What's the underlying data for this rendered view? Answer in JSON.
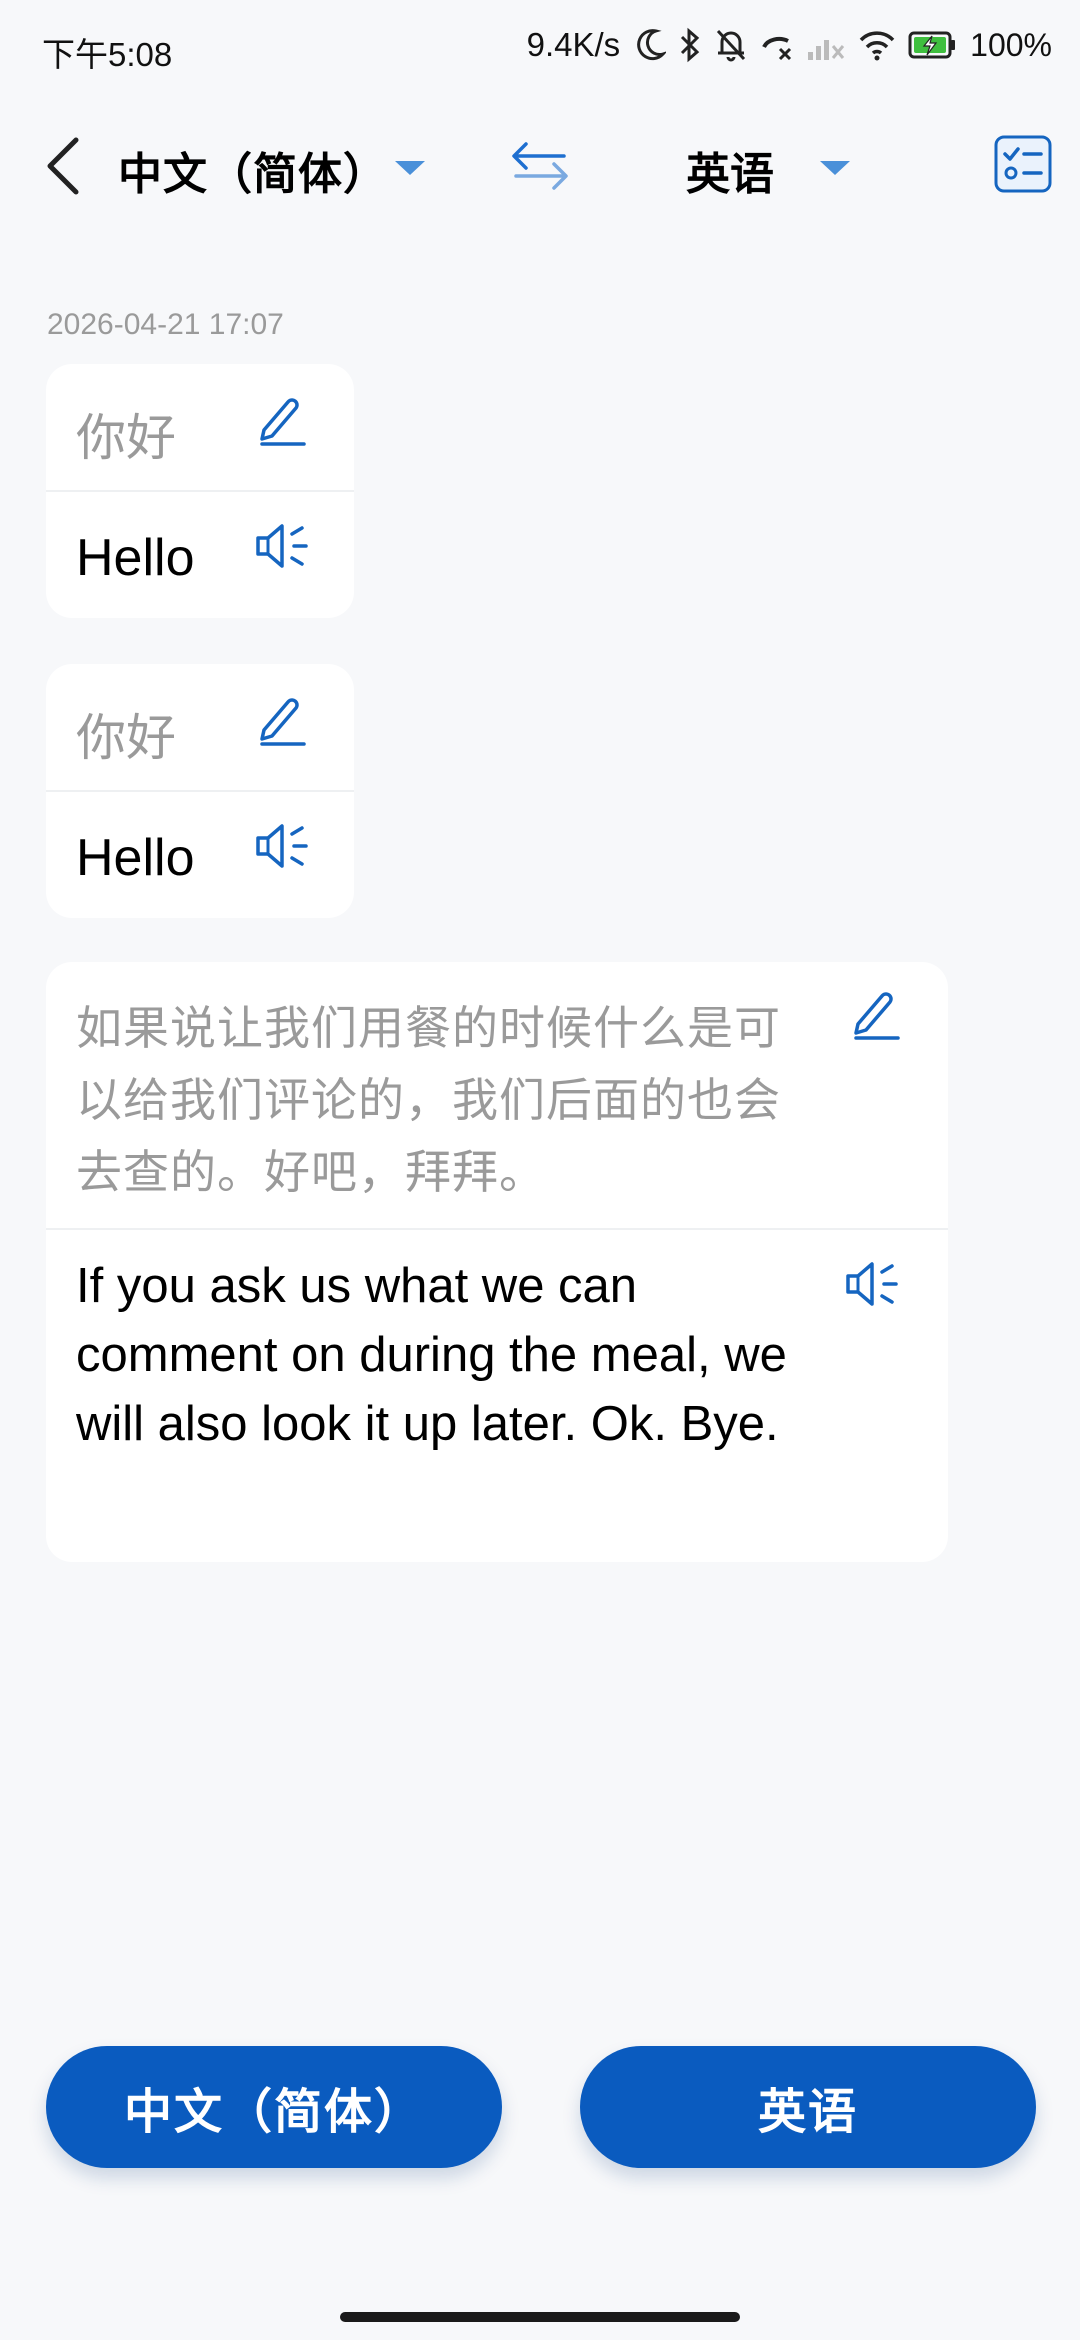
{
  "status_bar": {
    "time": "下午5:08",
    "net_speed": "9.4K/s",
    "battery": "100%"
  },
  "header": {
    "source_language": "中文（简体）",
    "target_language": "英语"
  },
  "conversation": {
    "date": "2026-04-21 17:07",
    "entries": [
      {
        "source": "你好",
        "translation": "Hello"
      },
      {
        "source": "你好",
        "translation": "Hello"
      },
      {
        "source": "如果说让我们用餐的时候什么是可以给我们评论的，我们后面的也会去查的。好吧，拜拜。",
        "translation": "If you ask us what we can comment on during the meal, we will also look it up later. Ok. Bye."
      }
    ]
  },
  "bottom": {
    "left_button": "中文（简体）",
    "right_button": "英语"
  },
  "colors": {
    "accent": "#0a5bbf",
    "icon_blue": "#1565c0",
    "background": "#f7f8fa"
  },
  "icons": [
    "back-arrow-icon",
    "dropdown-caret-icon",
    "swap-languages-icon",
    "history-checklist-icon",
    "edit-pencil-icon",
    "speaker-icon"
  ]
}
